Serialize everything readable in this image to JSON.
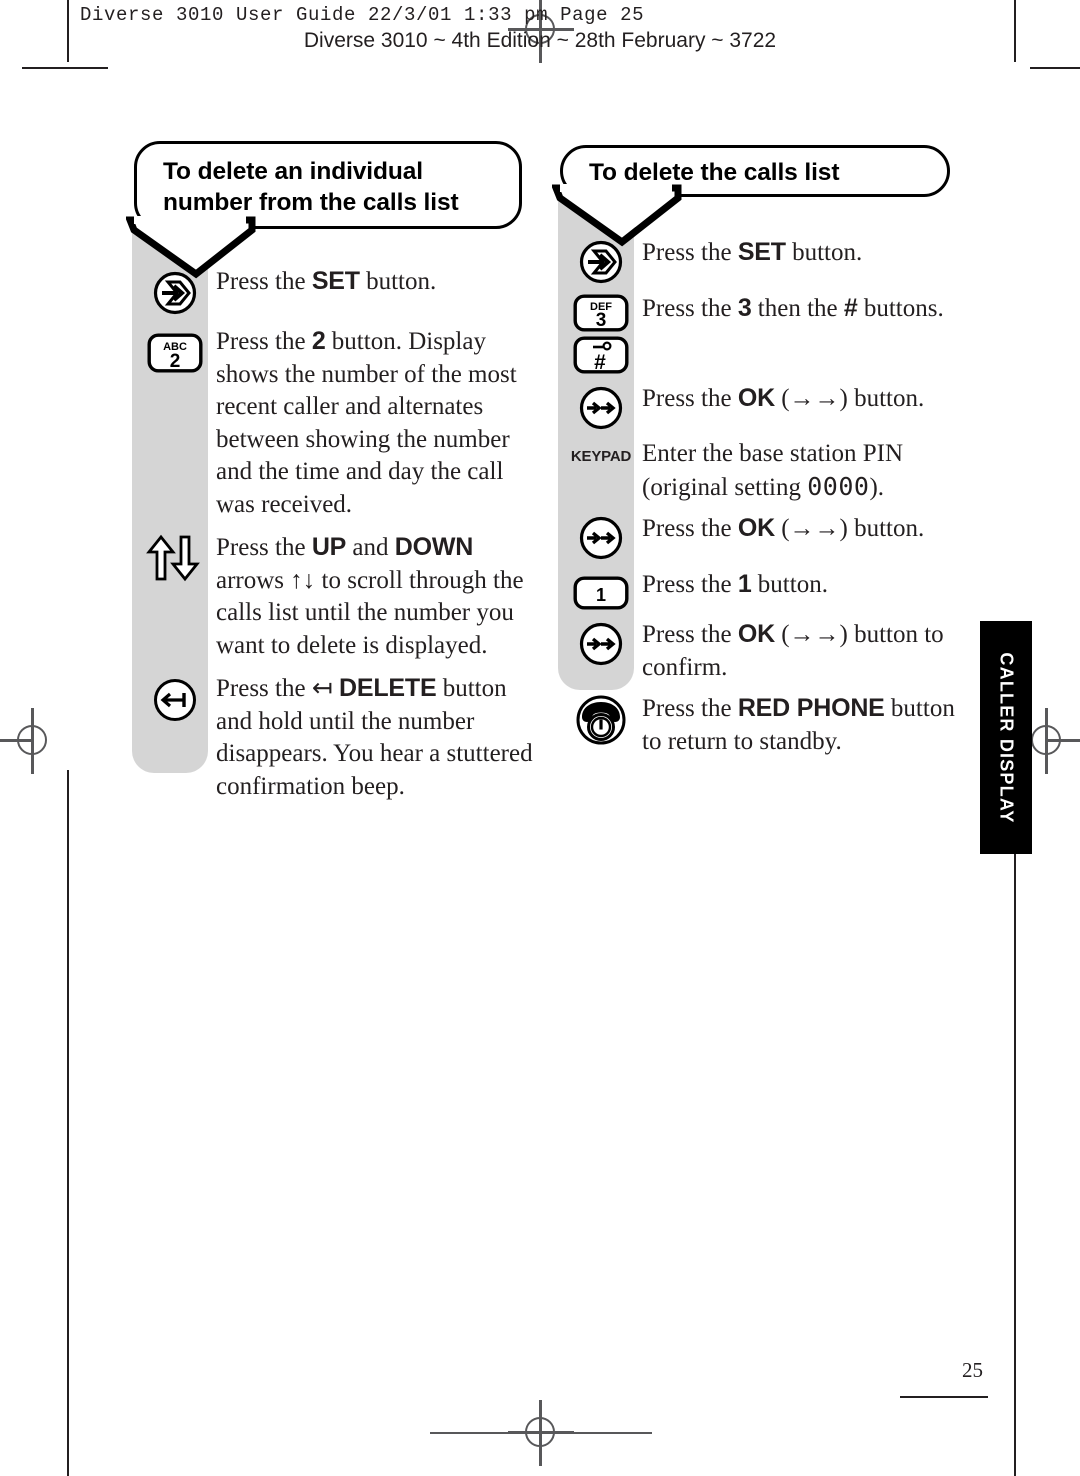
{
  "header": {
    "filename_line": "Diverse 3010 User Guide  22/3/01  1:33 pm  Page 25",
    "edition_line": "Diverse 3010 ~ 4th Edition ~ 28th February ~ 3722"
  },
  "side_tab": {
    "label": "CALLER DISPLAY"
  },
  "folio": {
    "page_number": "25"
  },
  "left_column": {
    "heading": "To delete an individual number from the calls list",
    "steps": [
      {
        "icon": "set-button-icon",
        "icon_label": "",
        "text_html": "Press the <b>SET</b> button."
      },
      {
        "icon": "keypad-2-icon",
        "icon_label": "2",
        "icon_sublabel": "ABC",
        "text_html": "Press the <b>2</b> button. Display shows the number of the most recent caller and alternates between showing the number and the time and day the call was received."
      },
      {
        "icon": "up-down-arrows-icon",
        "icon_label": "",
        "text_html": "Press the <b>UP</b> and <b>DOWN</b> arrows ↑↓ to scroll through the calls list until the number you want to delete is displayed."
      },
      {
        "icon": "delete-button-icon",
        "icon_label": "",
        "text_html": "Press the ↤ <b>DELETE</b> button and hold until the number disappears. You hear a stuttered confirmation beep."
      }
    ]
  },
  "right_column": {
    "heading": "To delete the calls list",
    "steps": [
      {
        "icon": "set-button-icon",
        "icon_label": "",
        "text_html": "Press the <b>SET</b> button."
      },
      {
        "icon": "keypad-3-hash-icon",
        "icon_label": "3",
        "icon_sublabel": "DEF",
        "icon_label2": "#",
        "text_html": "Press the <b>3</b> then the <b>#</b> buttons."
      },
      {
        "icon": "ok-button-icon",
        "icon_label": "",
        "text_html": "Press the <b>OK</b> (→→) button."
      },
      {
        "icon": "keypad-label-icon",
        "icon_label": "KEYPAD",
        "text_html": "Enter the base station PIN (original setting <span class=\"lcd\">0000</span>)."
      },
      {
        "icon": "ok-button-icon",
        "icon_label": "",
        "text_html": "Press the <b>OK</b> (→→) button."
      },
      {
        "icon": "keypad-1-icon",
        "icon_label": "1",
        "text_html": "Press the <b>1</b> button."
      },
      {
        "icon": "ok-button-icon",
        "icon_label": "",
        "text_html": "Press the <b>OK</b> (→→) button to confirm."
      },
      {
        "icon": "red-phone-button-icon",
        "icon_label": "",
        "text_html": "Press the <b>RED PHONE</b> button to return to standby."
      }
    ]
  },
  "colors": {
    "gray_strip": "#d5d5d5",
    "ink": "#231f20",
    "tab_background": "#000000",
    "registration": "#58585a"
  }
}
